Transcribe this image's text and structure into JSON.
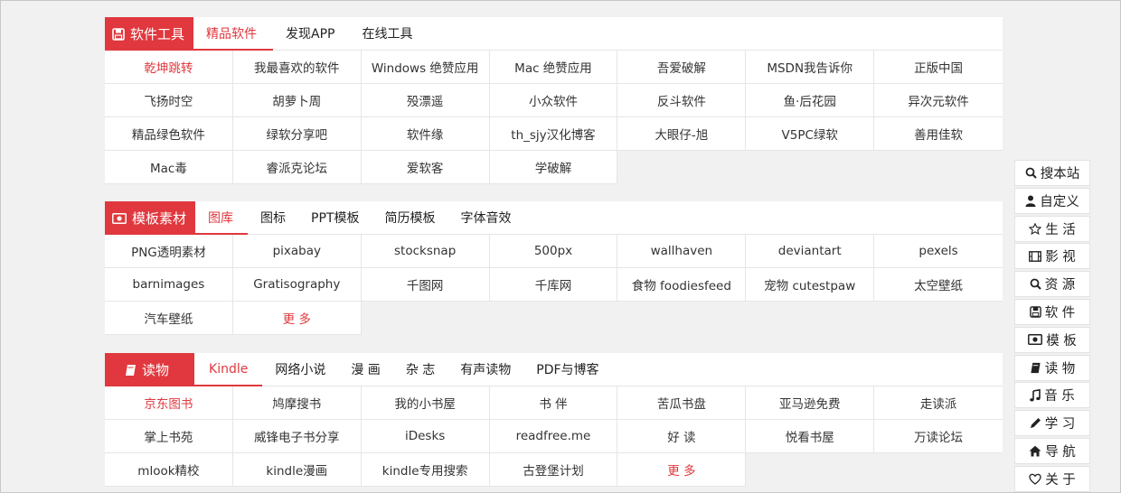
{
  "accent_color": "#e0383e",
  "sections": [
    {
      "title": "软件工具",
      "icon": "floppy-disk-icon",
      "tabs": [
        "精品软件",
        "发现APP",
        "在线工具"
      ],
      "active_tab": 0,
      "cells": [
        "乾坤跳转",
        "我最喜欢的软件",
        "Windows 绝赞应用",
        "Mac 绝赞应用",
        "吾爱破解",
        "MSDN我告诉你",
        "正版中国",
        "飞扬时空",
        "胡萝卜周",
        "殁漂遥",
        "小众软件",
        "反斗软件",
        "鱼·后花园",
        "异次元软件",
        "精品绿色软件",
        "绿软分享吧",
        "软件缘",
        "th_sjy汉化博客",
        "大眼仔-旭",
        "V5PC绿软",
        "善用佳软",
        "Mac毒",
        "睿派克论坛",
        "爱软客",
        "学破解"
      ],
      "red_cells": [
        "乾坤跳转"
      ]
    },
    {
      "title": "模板素材",
      "icon": "banknote-icon",
      "tabs": [
        "图库",
        "图标",
        "PPT模板",
        "简历模板",
        "字体音效"
      ],
      "active_tab": 0,
      "cells": [
        "PNG透明素材",
        "pixabay",
        "stocksnap",
        "500px",
        "wallhaven",
        "deviantart",
        "pexels",
        "barnimages",
        "Gratisography",
        "千图网",
        "千库网",
        "食物 foodiesfeed",
        "宠物 cutestpaw",
        "太空壁纸",
        "汽车壁纸",
        "更 多"
      ],
      "red_cells": [
        "更 多"
      ]
    },
    {
      "title": "读物",
      "icon": "book-icon",
      "tabs": [
        "Kindle",
        "网络小说",
        "漫 画",
        "杂 志",
        "有声读物",
        "PDF与博客"
      ],
      "active_tab": 0,
      "cells": [
        "京东图书",
        "鸠摩搜书",
        "我的小书屋",
        "书 伴",
        "苦瓜书盘",
        "亚马逊免费",
        "走读派",
        "掌上书苑",
        "威锋电子书分享",
        "iDesks",
        "readfree.me",
        "好 读",
        "悦看书屋",
        "万读论坛",
        "mlook精校",
        "kindle漫画",
        "kindle专用搜索",
        "古登堡计划",
        "更 多"
      ],
      "red_cells": [
        "京东图书",
        "更 多"
      ]
    }
  ],
  "sidenav": [
    {
      "label": "搜本站",
      "icon": "search-icon"
    },
    {
      "label": "自定义",
      "icon": "user-icon"
    },
    {
      "label": "生 活",
      "icon": "star-icon"
    },
    {
      "label": "影 视",
      "icon": "film-icon"
    },
    {
      "label": "资 源",
      "icon": "search-icon"
    },
    {
      "label": "软 件",
      "icon": "floppy-disk-icon"
    },
    {
      "label": "模 板",
      "icon": "banknote-icon"
    },
    {
      "label": "读 物",
      "icon": "book-icon"
    },
    {
      "label": "音 乐",
      "icon": "music-icon"
    },
    {
      "label": "学 习",
      "icon": "pencil-icon"
    },
    {
      "label": "导 航",
      "icon": "home-icon"
    },
    {
      "label": "关 于",
      "icon": "heart-icon"
    }
  ]
}
